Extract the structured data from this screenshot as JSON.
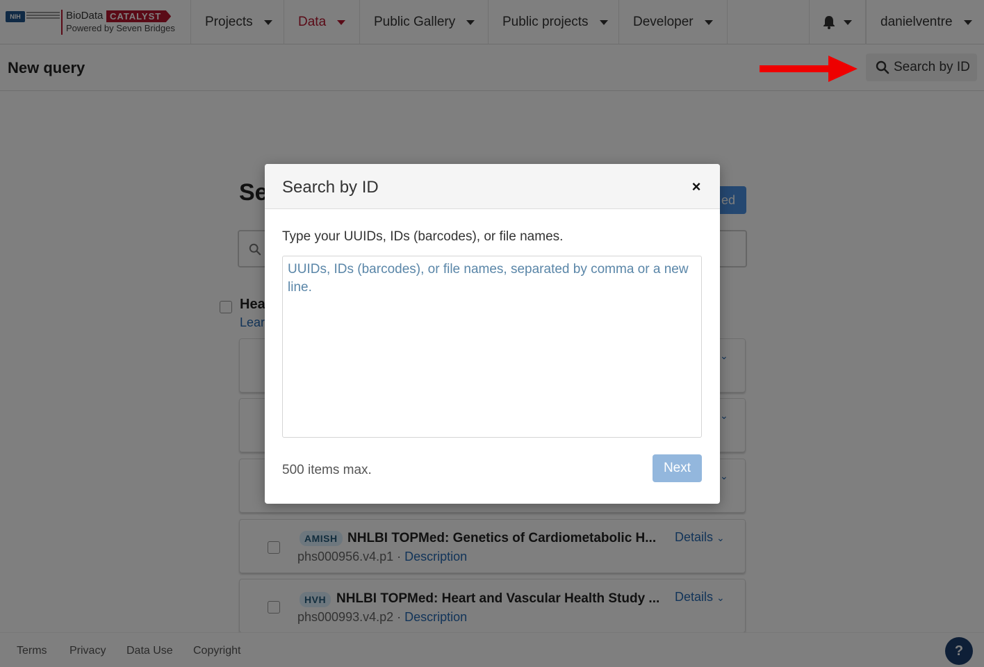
{
  "brand": {
    "nih_badge": "NIH",
    "bio": "BioData",
    "catalyst": "CATALYST",
    "powered_by": "Powered by Seven Bridges"
  },
  "nav": {
    "items": [
      {
        "label": "Projects",
        "active": false
      },
      {
        "label": "Data",
        "active": true
      },
      {
        "label": "Public Gallery",
        "active": false
      },
      {
        "label": "Public projects",
        "active": false
      },
      {
        "label": "Developer",
        "active": false
      }
    ],
    "username": "danielventre"
  },
  "subheader": {
    "title": "New query",
    "search_by_id_label": "Search by ID"
  },
  "background": {
    "heading_fragment": "Se",
    "pill_fragment": "ed",
    "group_title_fragment": "Hea",
    "group_link_fragment": "Lear",
    "studies": [
      {
        "badge": "AMISH",
        "title": "NHLBI TOPMed: Genetics of Cardiometabolic H...",
        "accession": "phs000956.v4.p1",
        "separator": " · ",
        "description_label": "Description",
        "details_label": "Details"
      },
      {
        "badge": "HVH",
        "title": "NHLBI TOPMed: Heart and Vascular Health Study ...",
        "accession": "phs000993.v4.p2",
        "separator": " · ",
        "description_label": "Description",
        "details_label": "Details"
      }
    ]
  },
  "modal": {
    "title": "Search by ID",
    "close_glyph": "×",
    "instructions": "Type your UUIDs, IDs (barcodes), or file names.",
    "textarea_value": "",
    "textarea_placeholder": "UUIDs, IDs (barcodes), or file names, separated by comma or a new line.",
    "max_note": "500 items max.",
    "next_label": "Next"
  },
  "footer": {
    "links": [
      "Terms",
      "Privacy",
      "Data Use",
      "Copyright"
    ],
    "help_glyph": "?"
  },
  "icons": {
    "search": "search-icon",
    "bell": "bell-icon",
    "caret": "caret-down-icon",
    "chevron": "chevron-down-icon",
    "arrow": "red-arrow-icon"
  },
  "colors": {
    "brand_red": "#b5172f",
    "link_blue": "#2469b3",
    "next_button": "#93b7dd",
    "help_button": "#1d3f6e",
    "arrow_red": "#ee0000"
  }
}
